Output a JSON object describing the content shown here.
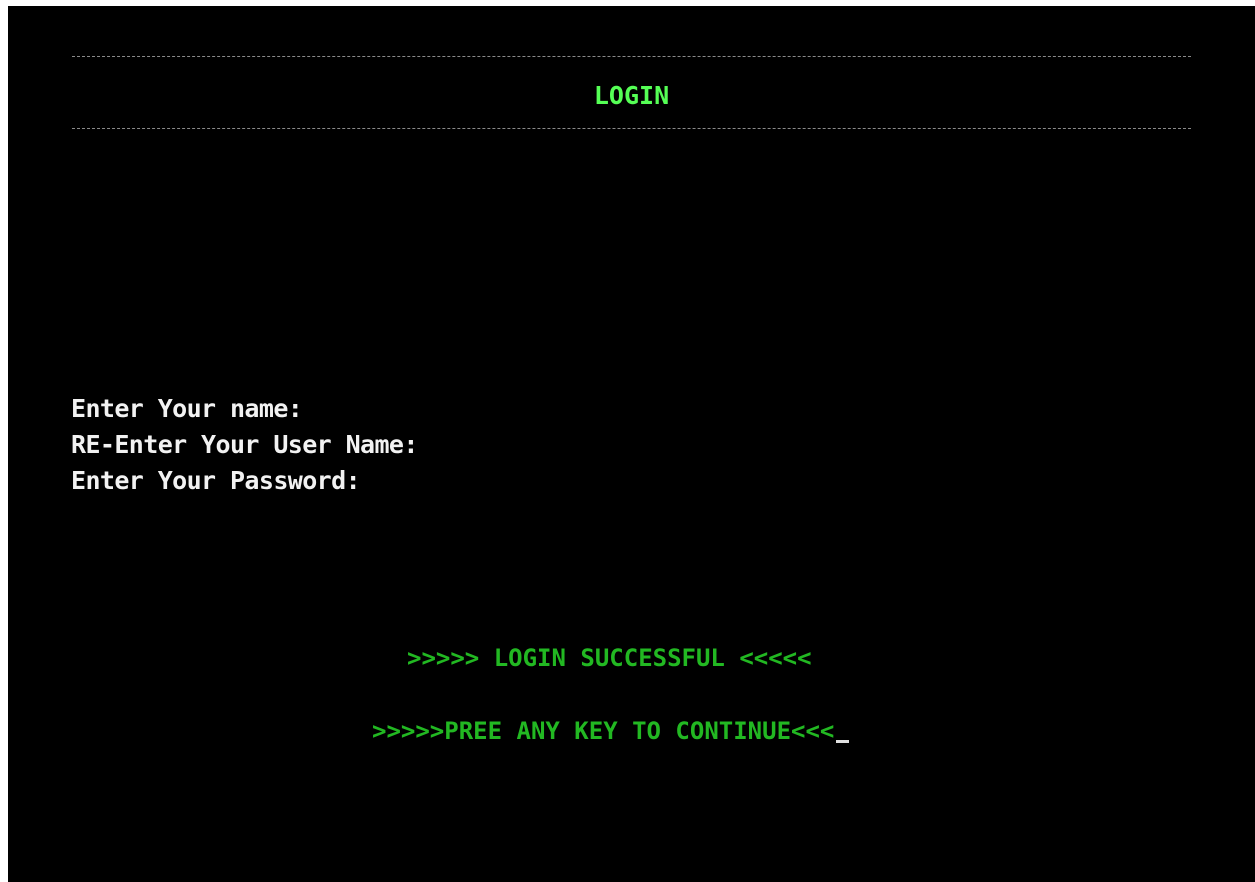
{
  "screen": {
    "title": "LOGIN",
    "prompts": [
      "Enter Your name:",
      "RE-Enter Your User Name:",
      "Enter Your Password:"
    ],
    "status_message": ">>>>> LOGIN SUCCESSFUL <<<<<",
    "continue_message": ">>>>>PREE ANY KEY TO CONTINUE<<<"
  },
  "colors": {
    "background": "#000000",
    "title_text": "#55ff55",
    "status_text": "#22b822",
    "prompt_text": "#f2f2f2",
    "divider": "#8a8a8a"
  }
}
